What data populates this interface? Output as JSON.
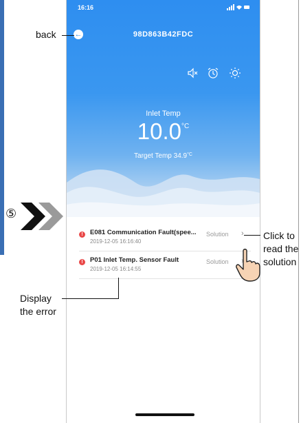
{
  "status_bar": {
    "time": "16:16",
    "icons": "๜•▮"
  },
  "header": {
    "title": "98D863B42FDC"
  },
  "controls": [
    "mute-icon",
    "alarm-clock-icon",
    "sun-icon"
  ],
  "readout": {
    "inlet_label": "Inlet Temp",
    "inlet_value": "10.0",
    "inlet_unit": "°C",
    "target_label": "Target Temp",
    "target_value": "34.9",
    "target_unit": "°C"
  },
  "errors": [
    {
      "name": "E081 Communication Fault(spee...",
      "time": "2019-12-05 16:16:40",
      "action": "Solution"
    },
    {
      "name": "P01 Inlet Temp. Sensor Fault",
      "time": "2019-12-05 16:14:55",
      "action": "Solution"
    }
  ],
  "annotations": {
    "back": "back",
    "step": "⑤",
    "click_line1": "Click to",
    "click_line2": "read the",
    "click_line3": "solution",
    "display_line1": "Display",
    "display_line2": "the error"
  },
  "colors": {
    "hero_top": "#2e8ef0",
    "error_dot": "#e94848",
    "side_bar": "#3a6fb4"
  }
}
